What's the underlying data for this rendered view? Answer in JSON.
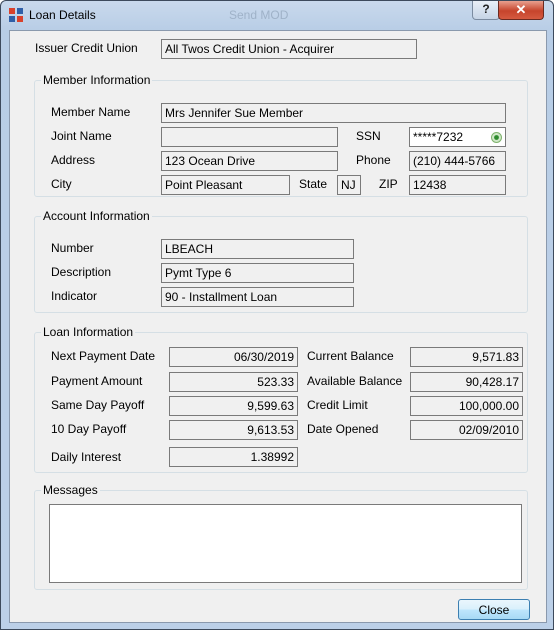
{
  "window": {
    "title": "Loan Details",
    "ghost_title": "Send MOD",
    "help": "?",
    "close": "✕"
  },
  "issuer": {
    "label": "Issuer Credit Union",
    "value": "All Twos Credit Union - Acquirer"
  },
  "member": {
    "title": "Member Information",
    "name_label": "Member Name",
    "name": "Mrs Jennifer Sue Member",
    "joint_label": "Joint Name",
    "joint": "",
    "ssn_label": "SSN",
    "ssn": "*****7232",
    "address_label": "Address",
    "address": "123 Ocean Drive",
    "phone_label": "Phone",
    "phone": "(210) 444-5766",
    "city_label": "City",
    "city": "Point Pleasant",
    "state_label": "State",
    "state": "NJ",
    "zip_label": "ZIP",
    "zip": "12438"
  },
  "account": {
    "title": "Account Information",
    "number_label": "Number",
    "number": "LBEACH",
    "description_label": "Description",
    "description": "Pymt Type 6",
    "indicator_label": "Indicator",
    "indicator": "90 - Installment Loan"
  },
  "loan": {
    "title": "Loan Information",
    "next_payment_date_label": "Next Payment Date",
    "next_payment_date": "06/30/2019",
    "payment_amount_label": "Payment Amount",
    "payment_amount": "523.33",
    "same_day_payoff_label": "Same Day Payoff",
    "same_day_payoff": "9,599.63",
    "ten_day_payoff_label": "10 Day Payoff",
    "ten_day_payoff": "9,613.53",
    "daily_interest_label": "Daily Interest",
    "daily_interest": "1.38992",
    "current_balance_label": "Current Balance",
    "current_balance": "9,571.83",
    "available_balance_label": "Available Balance",
    "available_balance": "90,428.17",
    "credit_limit_label": "Credit Limit",
    "credit_limit": "100,000.00",
    "date_opened_label": "Date Opened",
    "date_opened": "02/09/2010"
  },
  "messages": {
    "title": "Messages",
    "text": ""
  },
  "buttons": {
    "close": "Close"
  }
}
